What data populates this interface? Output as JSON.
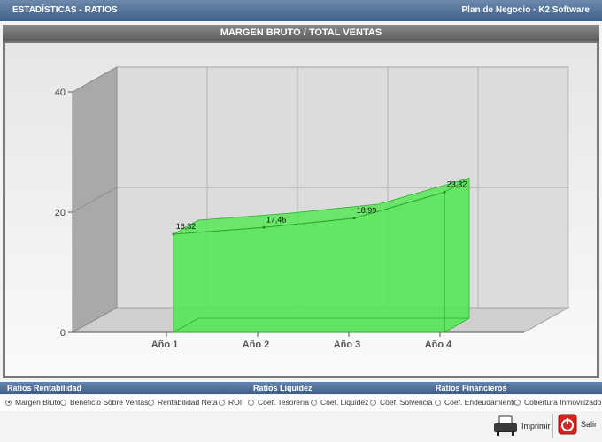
{
  "window": {
    "title": "ESTADÍSTICAS - RATIOS",
    "app_name": "Plan de Negocio · K2 Software"
  },
  "chart_data": {
    "type": "area",
    "title": "MARGEN BRUTO / TOTAL VENTAS",
    "categories": [
      "Año 1",
      "Año 2",
      "Año 3",
      "Año 4"
    ],
    "values": [
      16.32,
      17.46,
      18.99,
      23.32
    ],
    "data_labels": [
      "16,32",
      "17,46",
      "18,99",
      "23,32"
    ],
    "y_ticks": [
      "0",
      "20",
      "40"
    ],
    "ylim": [
      0,
      40
    ],
    "grid": true,
    "style": "3d",
    "color": "#4de84d"
  },
  "ratio_groups": {
    "rentabilidad": "Ratios Rentabilidad",
    "liquidez": "Ratios Liquidez",
    "financieros": "Ratios Financieros"
  },
  "radio_options": [
    {
      "label": "Margen Bruto",
      "selected": true
    },
    {
      "label": "Beneficio Sobre Ventas",
      "selected": false
    },
    {
      "label": "Rentabilidad Neta",
      "selected": false
    },
    {
      "label": "ROI",
      "selected": false
    },
    {
      "label": "Coef. Tesorería",
      "selected": false
    },
    {
      "label": "Coef. Liquidez",
      "selected": false
    },
    {
      "label": "Coef. Solvencia",
      "selected": false
    },
    {
      "label": "Coef. Endeudamiento",
      "selected": false
    },
    {
      "label": "Cobertura Inmovilizado",
      "selected": false
    }
  ],
  "buttons": {
    "print_label": "Imprimir",
    "exit_label": "Salir"
  }
}
